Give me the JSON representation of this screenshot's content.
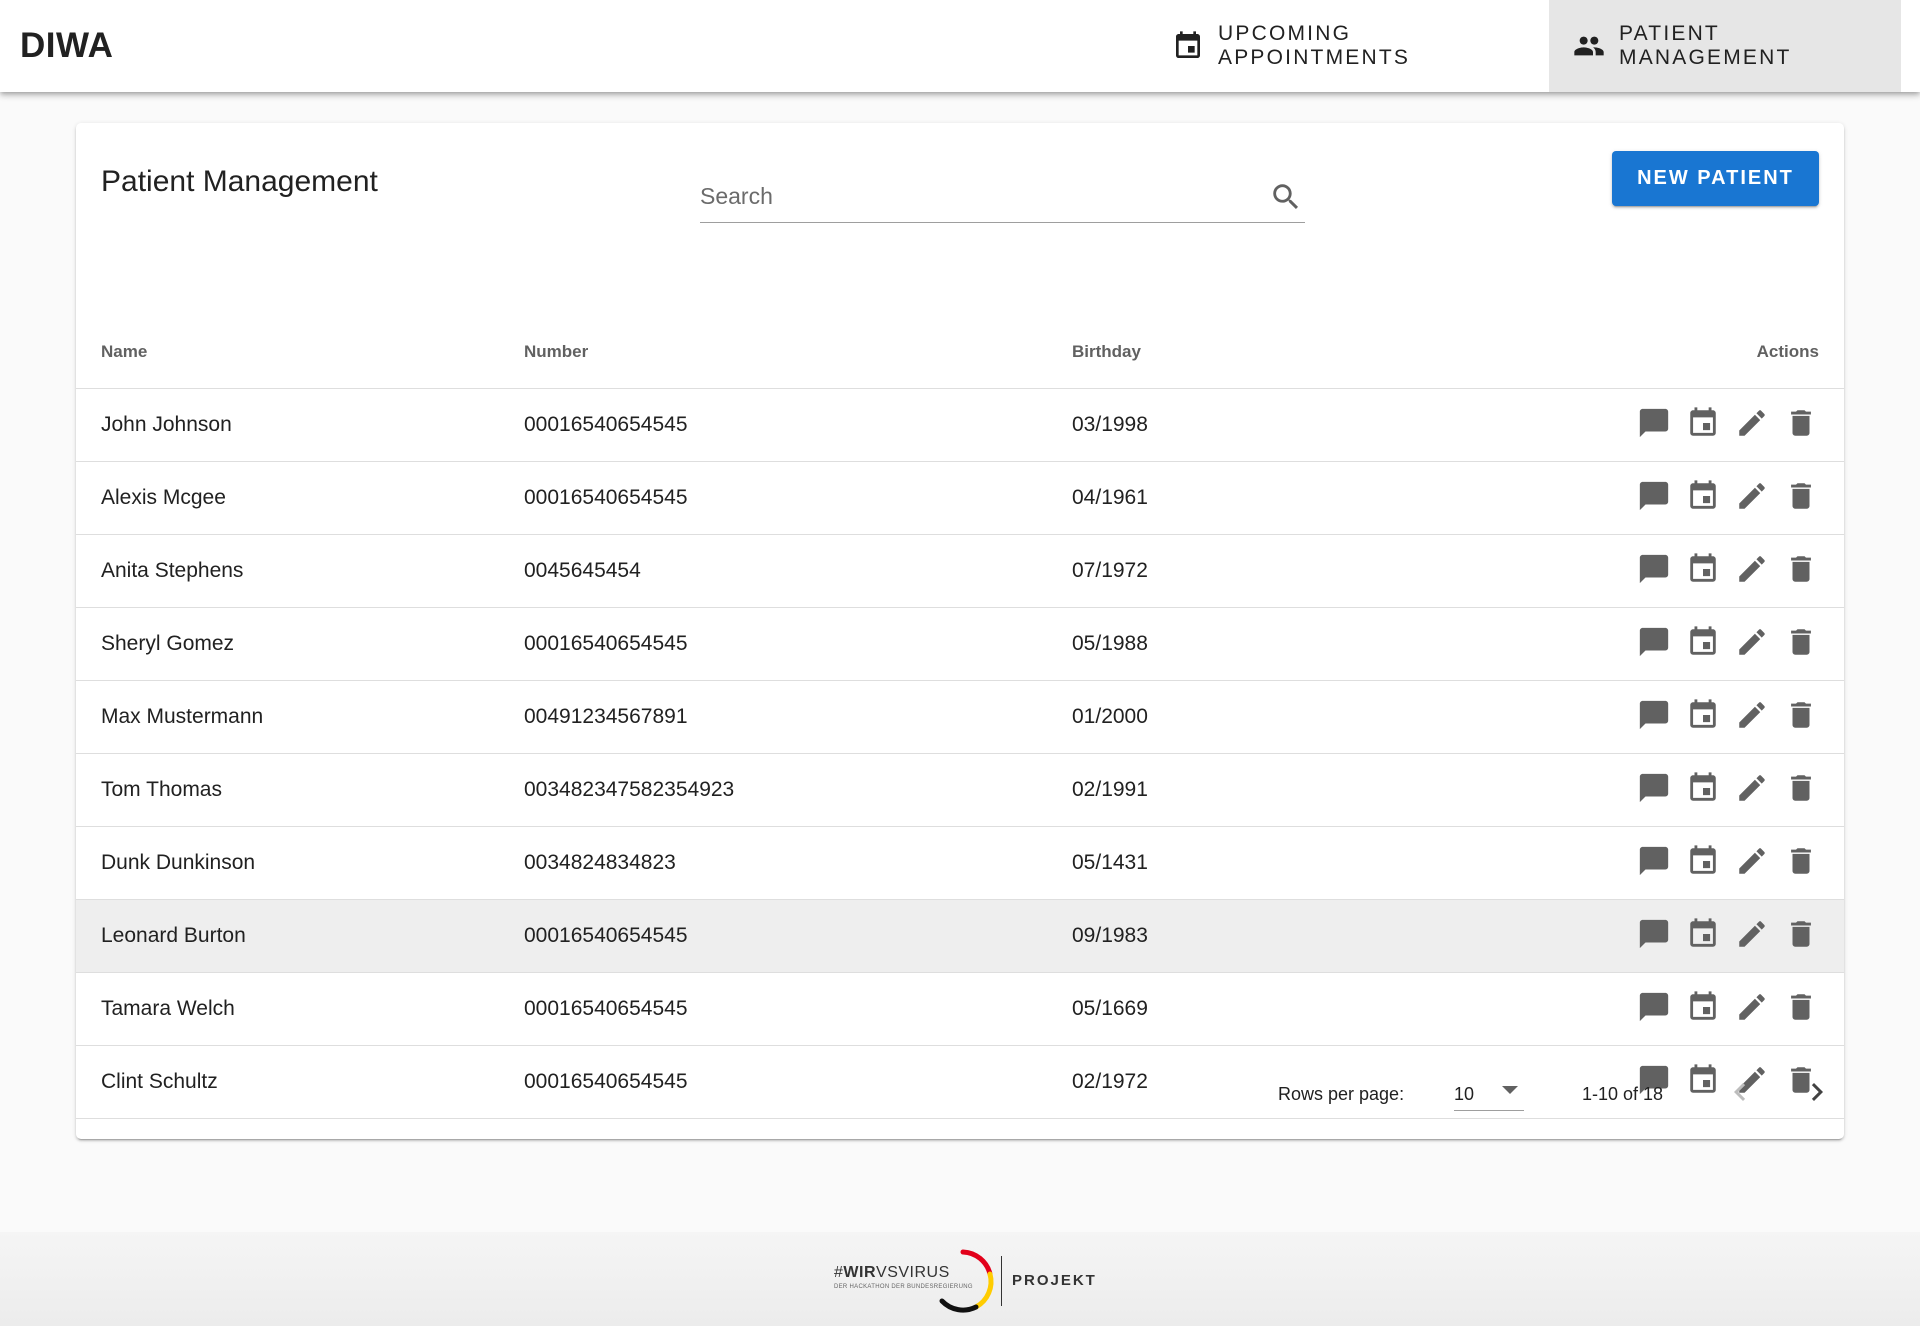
{
  "app": {
    "brand": "DIWA"
  },
  "nav": {
    "upcoming": "UPCOMING APPOINTMENTS",
    "patients": "PATIENT MANAGEMENT",
    "active": "patients"
  },
  "card": {
    "title": "Patient Management",
    "search_placeholder": "Search",
    "search_value": "",
    "new_patient_label": "NEW PATIENT"
  },
  "table": {
    "columns": {
      "name": "Name",
      "number": "Number",
      "birthday": "Birthday",
      "actions": "Actions"
    },
    "rows": [
      {
        "name": "John Johnson",
        "number": "00016540654545",
        "birthday": "03/1998"
      },
      {
        "name": "Alexis Mcgee",
        "number": "00016540654545",
        "birthday": "04/1961"
      },
      {
        "name": "Anita Stephens",
        "number": "0045645454",
        "birthday": "07/1972"
      },
      {
        "name": "Sheryl Gomez",
        "number": "00016540654545",
        "birthday": "05/1988"
      },
      {
        "name": "Max Mustermann",
        "number": "00491234567891",
        "birthday": "01/2000"
      },
      {
        "name": "Tom Thomas",
        "number": "003482347582354923",
        "birthday": "02/1991"
      },
      {
        "name": "Dunk Dunkinson",
        "number": "0034824834823",
        "birthday": "05/1431"
      },
      {
        "name": "Leonard Burton",
        "number": "00016540654545",
        "birthday": "09/1983"
      },
      {
        "name": "Tamara Welch",
        "number": "00016540654545",
        "birthday": "05/1669"
      },
      {
        "name": "Clint Schultz",
        "number": "00016540654545",
        "birthday": "02/1972"
      }
    ],
    "hovered_row": 7,
    "row_actions": [
      "message-icon",
      "calendar-icon",
      "edit-icon",
      "delete-icon"
    ]
  },
  "pagination": {
    "rows_per_page_label": "Rows per page:",
    "rows_per_page": "10",
    "range": "1-10 of 18"
  },
  "footer": {
    "logo_hash": "#",
    "logo_wir": "WIR",
    "logo_vs": "VS",
    "logo_virus": "VIRUS",
    "logo_sub": "DER HACKATHON DER BUNDESREGIERUNG",
    "logo_project": "PROJEKT"
  },
  "colors": {
    "primary": "#1976d2",
    "active_tab_bg": "#e6e6e6",
    "icon": "#616161"
  }
}
